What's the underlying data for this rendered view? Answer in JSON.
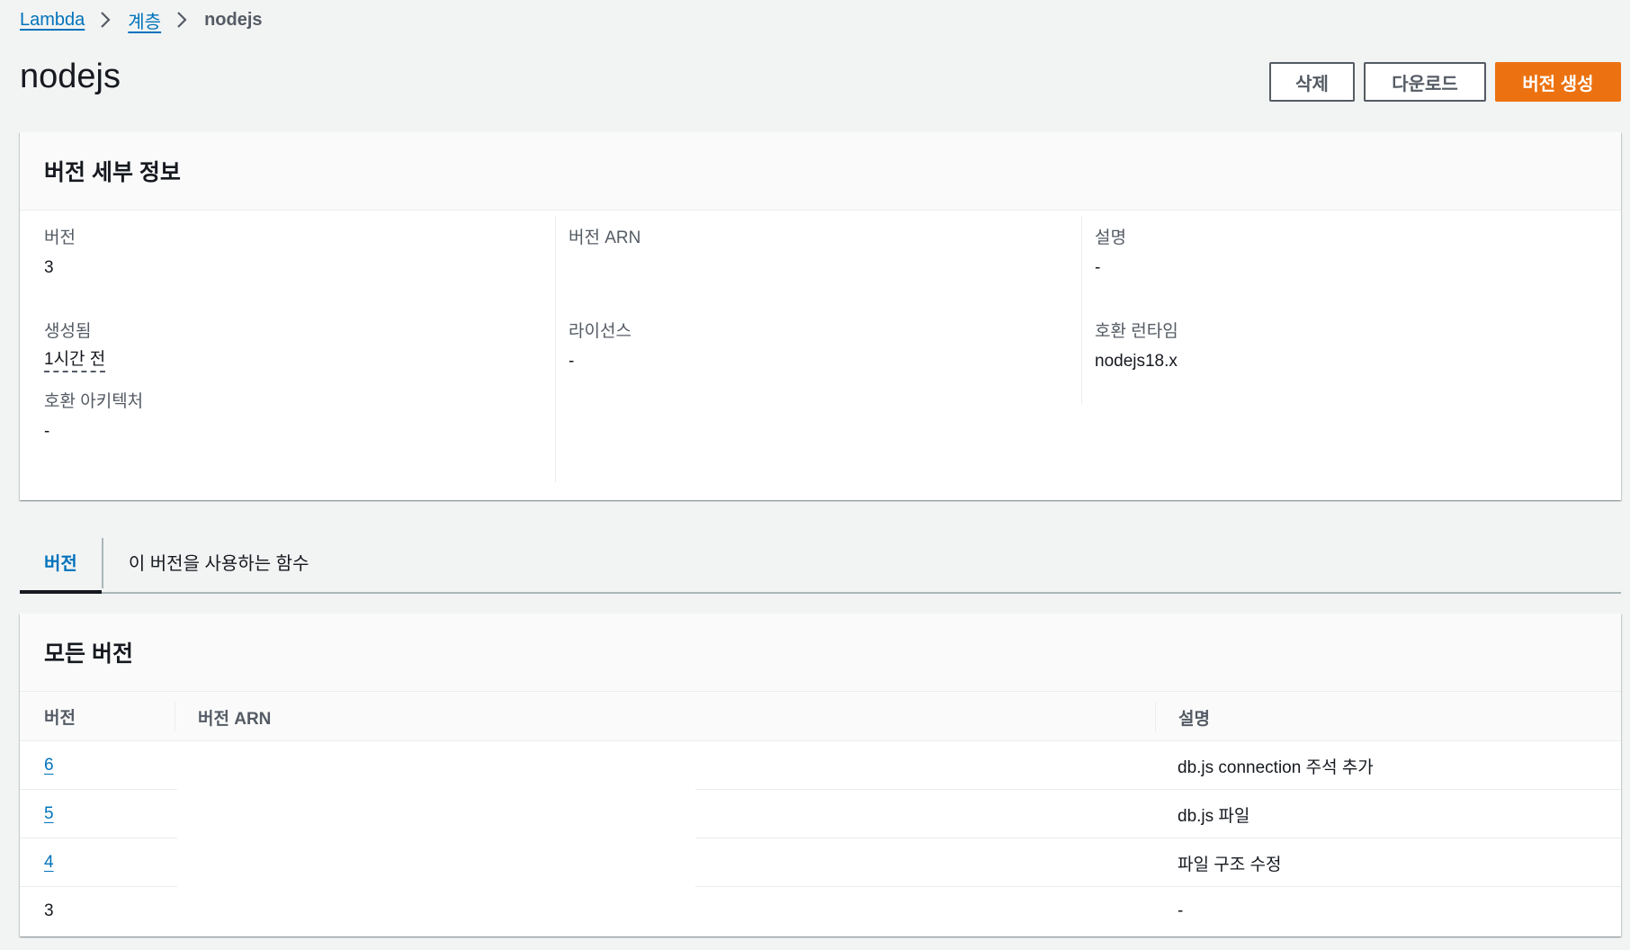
{
  "breadcrumb": {
    "items": [
      {
        "label": "Lambda"
      },
      {
        "label": "계층"
      }
    ],
    "current": "nodejs"
  },
  "page_title": "nodejs",
  "actions": {
    "delete_label": "삭제",
    "download_label": "다운로드",
    "create_version_label": "버전 생성"
  },
  "details": {
    "title": "버전 세부 정보",
    "version_label": "버전",
    "version_value": "3",
    "arn_label": "버전 ARN",
    "arn_value": "",
    "description_label": "설명",
    "description_value": "-",
    "created_label": "생성됨",
    "created_value": "1시간 전",
    "license_label": "라이선스",
    "license_value": "-",
    "runtime_label": "호환 런타임",
    "runtime_value": "nodejs18.x",
    "arch_label": "호환 아키텍처",
    "arch_value": "-"
  },
  "tabs": [
    {
      "label": "버전",
      "active": true
    },
    {
      "label": "이 버전을 사용하는 함수",
      "active": false
    }
  ],
  "versions_table": {
    "title": "모든 버전",
    "columns": [
      "버전",
      "버전 ARN",
      "설명"
    ],
    "rows": [
      {
        "version": "6",
        "link": true,
        "arn": "",
        "description": "db.js connection 주석 추가"
      },
      {
        "version": "5",
        "link": true,
        "arn": "",
        "description": "db.js 파일"
      },
      {
        "version": "4",
        "link": true,
        "arn": "",
        "description": "파일 구조 수정"
      },
      {
        "version": "3",
        "link": false,
        "arn": "",
        "description": "-"
      }
    ]
  },
  "colors": {
    "link": "#0073bb",
    "primary_button": "#ec7211",
    "background": "#f2f3f3"
  }
}
